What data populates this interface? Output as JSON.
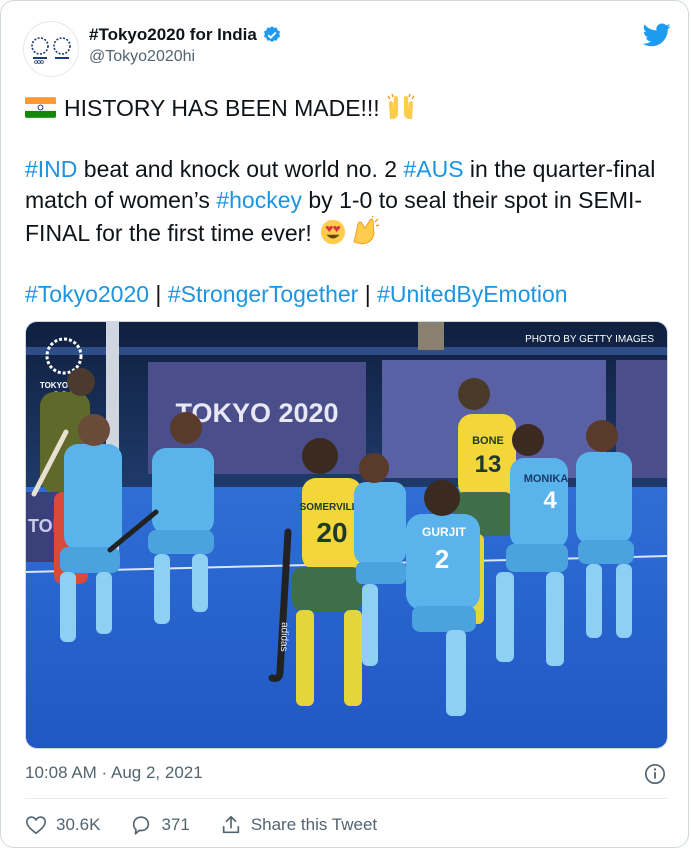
{
  "account": {
    "display_name": "#Tokyo2020 for India",
    "handle": "@Tokyo2020hi"
  },
  "tweet": {
    "line1": "HISTORY HAS BEEN MADE!!!",
    "p2": {
      "h_ind": "#IND",
      "t1": " beat and knock out world no. 2 ",
      "h_aus": "#AUS",
      "t2": " in the quarter-final match of women’s ",
      "h_hockey": "#hockey",
      "t3": " by 1-0 to seal their spot in SEMI-FINAL for the first time ever!"
    },
    "tags": {
      "tag1": "#Tokyo2020",
      "sep1": " | ",
      "tag2": "#StrongerTogether",
      "sep2": " | ",
      "tag3": "#UnitedByEmotion"
    }
  },
  "photo": {
    "credit": "PHOTO BY GETTY IMAGES",
    "banner": "TOKYO 2020",
    "banner_left": "TOKY",
    "logo_text": "TOKYO 2020",
    "jerseys": {
      "bone": "BONE",
      "bone_num": "13",
      "somerville": "SOMERVILLE",
      "somerville_num": "20",
      "monika": "MONIKA",
      "monika_num": "4",
      "gurjit": "GURJIT",
      "gurjit_num": "2",
      "stick_brand": "adidas"
    }
  },
  "meta": {
    "timestamp": "10:08 AM · Aug 2, 2021"
  },
  "actions": {
    "likes": "30.6K",
    "replies": "371",
    "share": "Share this Tweet"
  },
  "colors": {
    "hashtag": "#1b95e0",
    "twitter_blue": "#1d9bf0",
    "turf": "#2f6fd6",
    "india_jersey": "#5ab3ea",
    "aus_jersey": "#f3d63a"
  },
  "icons": [
    "verified-icon",
    "twitter-bird-icon",
    "india-flag-icon",
    "raising-hands-icon",
    "heart-eyes-icon",
    "clapping-icon",
    "info-icon",
    "heart-icon",
    "reply-icon",
    "share-icon"
  ]
}
